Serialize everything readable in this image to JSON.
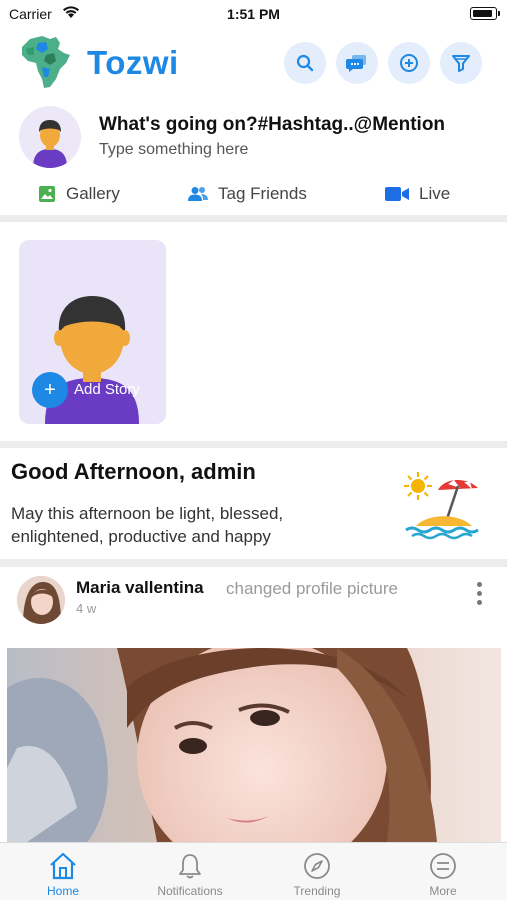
{
  "status_bar": {
    "carrier": "Carrier",
    "time": "1:51 PM"
  },
  "header": {
    "brand": "Tozwi",
    "buttons": [
      "search-icon",
      "chat-icon",
      "add-circle-icon",
      "filter-icon"
    ],
    "accent_color": "#1e88e5"
  },
  "composer": {
    "prompt": "What's going on?#Hashtag..@Mention",
    "placeholder": "Type something here",
    "actions": [
      {
        "label": "Gallery",
        "icon": "gallery-icon",
        "color": "#4caf50"
      },
      {
        "label": "Tag Friends",
        "icon": "people-icon",
        "color": "#1e88e5"
      },
      {
        "label": "Live",
        "icon": "video-camera-icon",
        "color": "#1e6fe5"
      }
    ]
  },
  "stories": {
    "add_label": "Add Story"
  },
  "greeting": {
    "title": "Good Afternoon, admin",
    "message": "May this afternoon be light, blessed, enlightened, productive and happy"
  },
  "post": {
    "author": "Maria vallentina",
    "action": "changed profile picture",
    "time": "4 w"
  },
  "tabbar": {
    "tabs": [
      {
        "label": "Home",
        "icon": "home-icon",
        "active": true
      },
      {
        "label": "Notifications",
        "icon": "bell-icon",
        "active": false
      },
      {
        "label": "Trending",
        "icon": "compass-icon",
        "active": false
      },
      {
        "label": "More",
        "icon": "menu-circle-icon",
        "active": false
      }
    ]
  }
}
